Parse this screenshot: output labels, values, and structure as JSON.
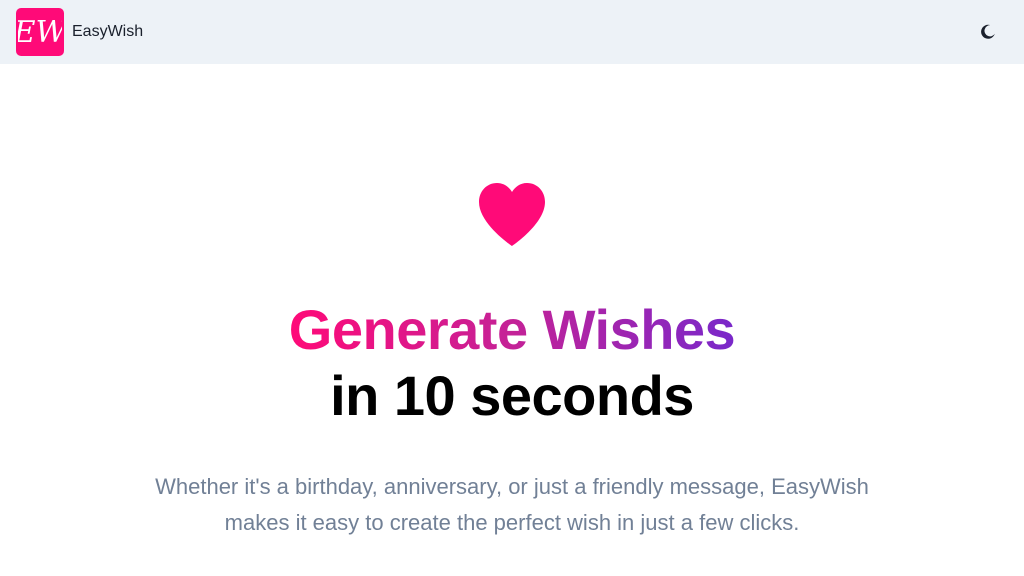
{
  "navbar": {
    "logo_text": "EW",
    "brand_name": "EasyWish",
    "theme_icon": "moon-icon"
  },
  "hero": {
    "icon": "heart-icon",
    "headline_gradient": "Generate Wishes",
    "headline_plain": "in 10 seconds",
    "description": "Whether it's a birthday, anniversary, or just a friendly message, EasyWish makes it easy to create the perfect wish in just a few clicks."
  },
  "colors": {
    "brand_pink": "#ff0a78",
    "gradient_end": "#7928ca",
    "navbar_bg": "#edf2f7",
    "text_muted": "#718096"
  }
}
